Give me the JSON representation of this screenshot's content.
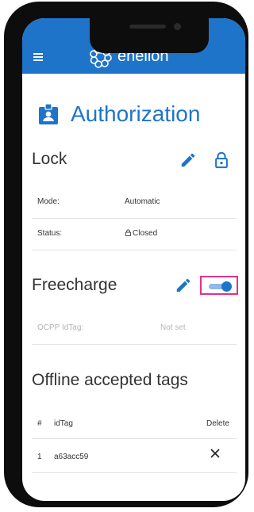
{
  "appbar": {
    "brand": "enelion",
    "menu_icon": "hamburger-menu-icon",
    "logo_icon": "enelion-logo-icon"
  },
  "page": {
    "title": "Authorization",
    "title_icon": "badge-id-icon"
  },
  "colors": {
    "primary": "#1e74c9",
    "highlight_border": "#e0338b",
    "toggle_track": "#8fb9e6"
  },
  "lock": {
    "title": "Lock",
    "edit_icon": "pencil-edit-icon",
    "lock_icon": "lock-open-icon",
    "rows": [
      {
        "label": "Mode:",
        "value": "Automatic"
      },
      {
        "label": "Status:",
        "value": "Closed",
        "icon": "padlock-icon"
      }
    ]
  },
  "freecharge": {
    "title": "Freecharge",
    "edit_icon": "pencil-edit-icon",
    "toggle_on": true,
    "row": {
      "label": "OCPP IdTag:",
      "value": "Not set"
    }
  },
  "offline": {
    "title": "Offline accepted tags",
    "columns": [
      "#",
      "idTag",
      "Delete"
    ],
    "rows": [
      {
        "index": "1",
        "idTag": "a63acc59",
        "delete_icon": "close-x-icon"
      }
    ]
  }
}
